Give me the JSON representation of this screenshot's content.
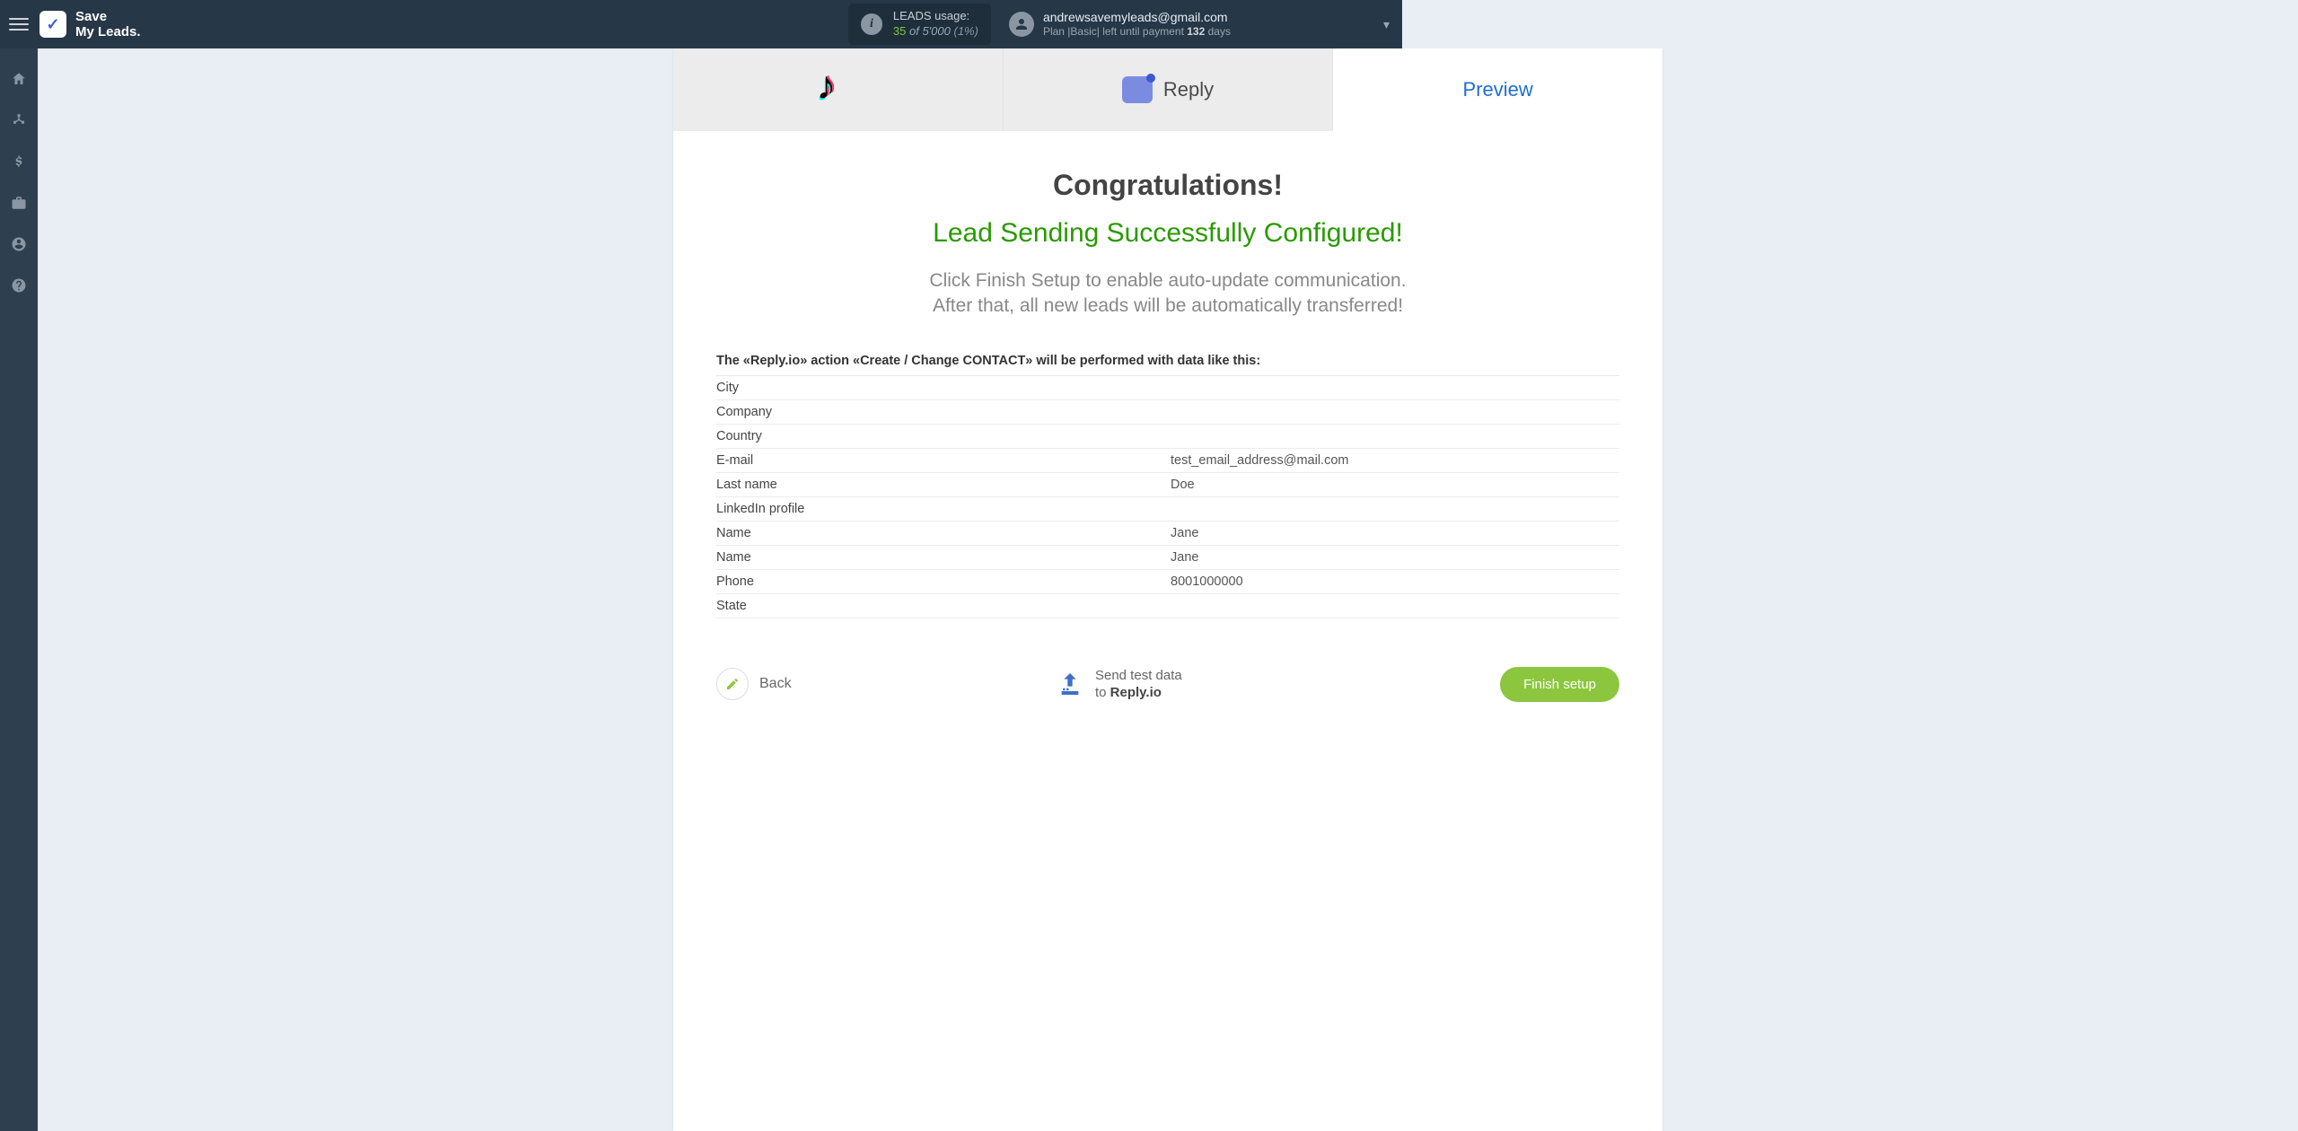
{
  "header": {
    "logo_line1": "Save",
    "logo_line2": "My Leads.",
    "usage_label": "LEADS usage:",
    "usage_current": "35",
    "usage_of": "of",
    "usage_total": "5'000",
    "usage_pct": "(1%)",
    "email": "andrewsavemyleads@gmail.com",
    "plan_prefix": "Plan |",
    "plan_name": "Basic",
    "plan_mid": "| left until payment ",
    "plan_days": "132",
    "plan_suffix": " days"
  },
  "steps": {
    "source_label": "",
    "dest_label": "Reply",
    "preview_label": "Preview"
  },
  "congrats": {
    "title": "Congratulations!",
    "subtitle": "Lead Sending Successfully Configured!",
    "desc_line1": "Click Finish Setup to enable auto-update communication.",
    "desc_line2": "After that, all new leads will be automatically transferred!"
  },
  "data_table": {
    "caption": "The «Reply.io» action «Create / Change CONTACT» will be performed with data like this:",
    "rows": [
      {
        "key": "City",
        "val": ""
      },
      {
        "key": "Company",
        "val": ""
      },
      {
        "key": "Country",
        "val": ""
      },
      {
        "key": "E-mail",
        "val": "test_email_address@mail.com"
      },
      {
        "key": "Last name",
        "val": "Doe"
      },
      {
        "key": "LinkedIn profile",
        "val": ""
      },
      {
        "key": "Name",
        "val": "Jane"
      },
      {
        "key": "Name",
        "val": "Jane"
      },
      {
        "key": "Phone",
        "val": "8001000000"
      },
      {
        "key": "State",
        "val": ""
      }
    ]
  },
  "footer": {
    "back_label": "Back",
    "send_line1": "Send test data",
    "send_line2_prefix": "to ",
    "send_line2_bold": "Reply.io",
    "finish_label": "Finish setup"
  }
}
